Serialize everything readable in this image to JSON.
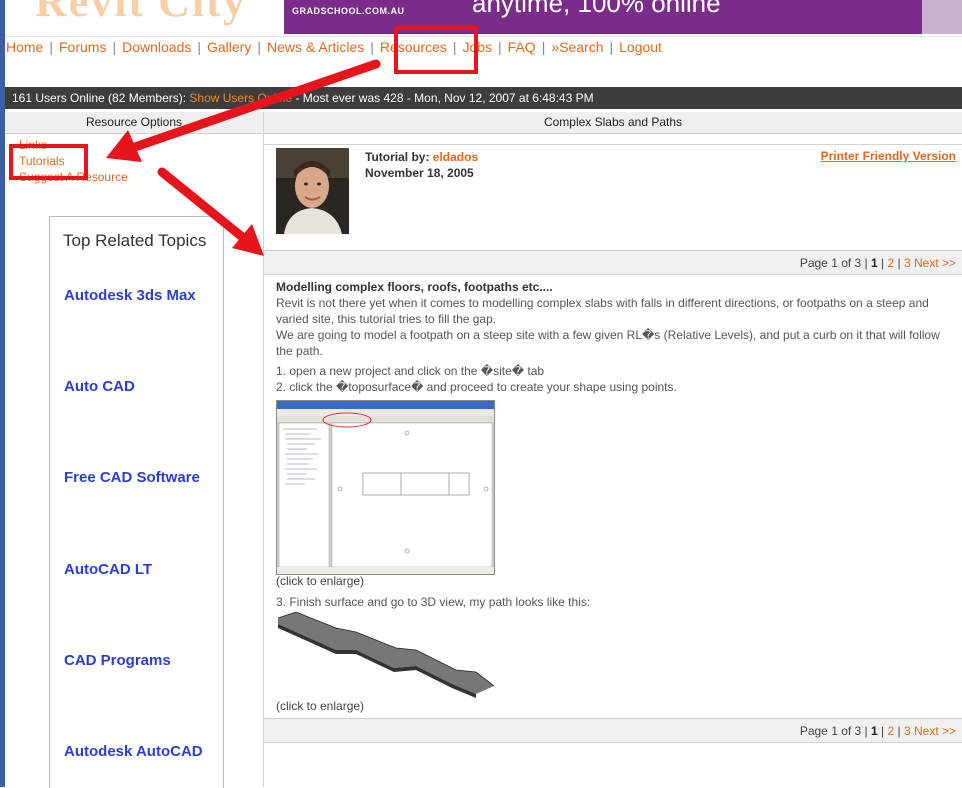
{
  "header": {
    "logo_text": "Revit City",
    "banner_site": "GRADSCHOOL.COM.AU",
    "banner_slogan": "anytime, 100% online"
  },
  "nav": {
    "items": [
      "Home",
      "Forums",
      "Downloads",
      "Gallery",
      "News & Articles",
      "Resources",
      "Jobs",
      "FAQ",
      "Search",
      "Logout"
    ],
    "search_glyph": "»"
  },
  "stats": {
    "prefix": "161 Users Online (82 Members): ",
    "show_users": "Show Users Online",
    "suffix": " - Most ever was 428 - Mon, Nov 12, 2007 at 6:48:43 PM"
  },
  "sidebar": {
    "header": "Resource Options",
    "links": [
      "Links",
      "Tutorials",
      "Suggest A Resource"
    ],
    "related_title": "Top Related Topics",
    "related_items": [
      "Autodesk 3ds Max",
      "Auto CAD",
      "Free CAD Software",
      "AutoCAD LT",
      "CAD Programs",
      "Autodesk AutoCAD"
    ]
  },
  "main": {
    "header": "Complex Slabs and Paths",
    "by_label": "Tutorial by: ",
    "author": "eldados",
    "date": "November 18, 2005",
    "printer_link": "Printer Friendly Version",
    "pager": {
      "label": "Page 1 of 3 | ",
      "current": "1",
      "sep": " | ",
      "page2": "2",
      "next": "3 Next >>"
    },
    "article_title": "Modelling complex floors, roofs, footpaths etc....",
    "paragraph1": "Revit is not there yet when it comes to modelling complex slabs with falls in different directions, or footpaths on a steep and varied site, this tutorial tries to fill the gap.",
    "paragraph2": "We are going to model a footpath on a steep site with a few given RL�s (Relative Levels), and put a curb on it that will follow the path.",
    "step1": "1.   open a new project and click on the �site� tab",
    "step2": "2.   click the �toposurface� and proceed to create your shape using points.",
    "caption1": "(click to enlarge)",
    "step3": "3.   Finish surface and go to 3D view, my path looks like this:",
    "caption2": "(click to enlarge)"
  },
  "annotation_color": "#e8141c",
  "accent_color": "#e06a1d",
  "link_blue": "#2b3ed1"
}
